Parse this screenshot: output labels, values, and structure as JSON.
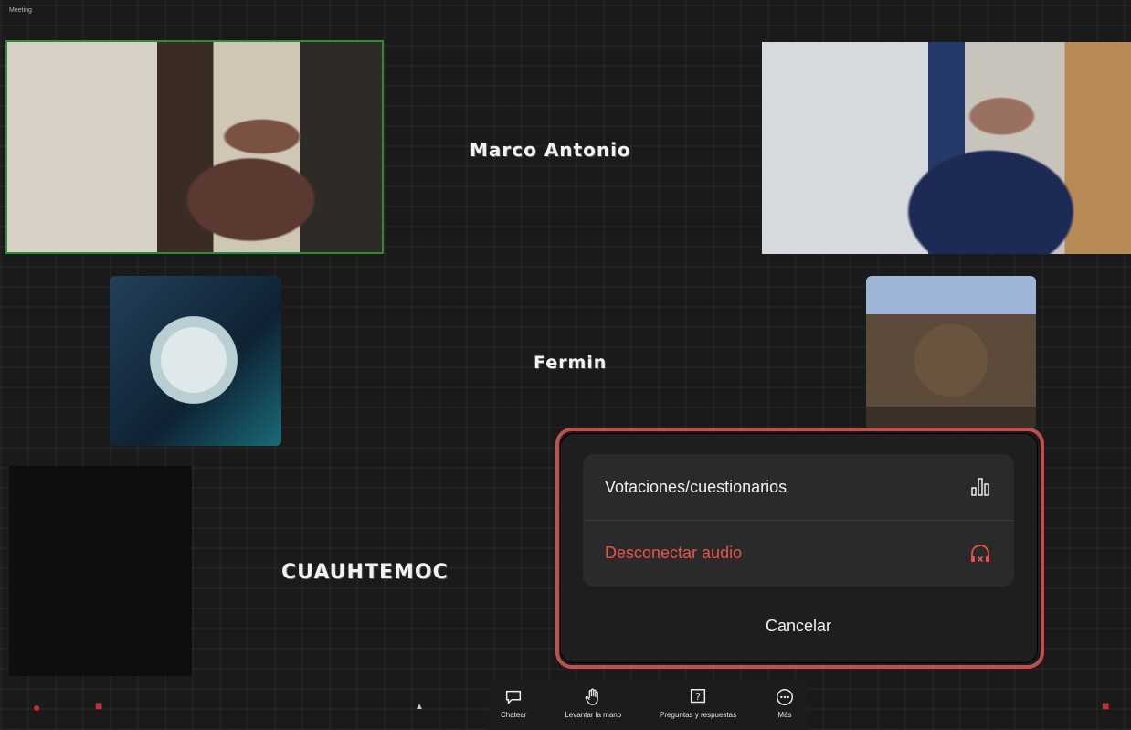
{
  "window": {
    "top_label": "Meeting"
  },
  "participants": {
    "tile1_name": "Marco Antonio",
    "tile2_name": "Fermin",
    "tile3_name": "CUAUHTEMOC"
  },
  "popup": {
    "items": [
      {
        "label": "Votaciones/cuestionarios",
        "icon": "bar-chart-icon"
      },
      {
        "label": "Desconectar audio",
        "icon": "headphones-disconnect-icon"
      }
    ],
    "cancel_label": "Cancelar",
    "danger_color": "#e5534b"
  },
  "toolbar": {
    "items": [
      {
        "label": "Chatear",
        "icon": "chat-icon"
      },
      {
        "label": "Levantar la mano",
        "icon": "raise-hand-icon"
      },
      {
        "label": "Preguntas y respuestas",
        "icon": "qa-icon"
      },
      {
        "label": "Más",
        "icon": "more-icon"
      }
    ]
  }
}
